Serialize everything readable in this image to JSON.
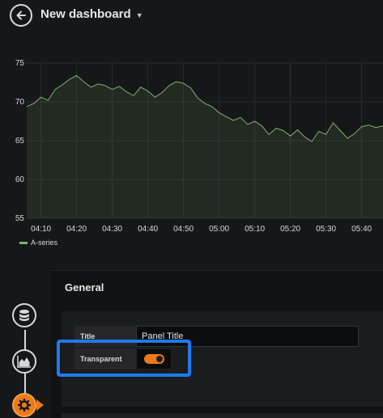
{
  "header": {
    "title": "New dashboard",
    "back_icon": "arrow-left-circle-icon",
    "caret_icon": "caret-down-icon"
  },
  "chart_data": {
    "type": "line",
    "title": "",
    "xlabel": "",
    "ylabel": "",
    "x_ticks": [
      "04:10",
      "04:20",
      "04:30",
      "04:40",
      "04:50",
      "05:00",
      "05:10",
      "05:20",
      "05:30",
      "05:40"
    ],
    "y_ticks": [
      "55",
      "60",
      "65",
      "70",
      "75"
    ],
    "ylim": [
      55,
      75
    ],
    "xlim": [
      "04:06",
      "05:46"
    ],
    "grid": true,
    "legend_position": "bottom-left",
    "series": [
      {
        "name": "A-series",
        "color": "#7eb26d",
        "x": [
          "04:06",
          "04:08",
          "04:10",
          "04:12",
          "04:14",
          "04:16",
          "04:18",
          "04:20",
          "04:22",
          "04:24",
          "04:26",
          "04:28",
          "04:30",
          "04:32",
          "04:34",
          "04:36",
          "04:38",
          "04:40",
          "04:42",
          "04:44",
          "04:46",
          "04:48",
          "04:50",
          "04:52",
          "04:54",
          "04:56",
          "04:58",
          "05:00",
          "05:02",
          "05:04",
          "05:06",
          "05:08",
          "05:10",
          "05:12",
          "05:14",
          "05:16",
          "05:18",
          "05:20",
          "05:22",
          "05:24",
          "05:26",
          "05:28",
          "05:30",
          "05:32",
          "05:34",
          "05:36",
          "05:38",
          "05:40",
          "05:42",
          "05:44",
          "05:46"
        ],
        "values": [
          69.4,
          69.8,
          70.6,
          70.2,
          71.6,
          72.2,
          72.9,
          73.4,
          72.6,
          71.9,
          72.3,
          72.1,
          71.6,
          72.0,
          71.3,
          70.8,
          71.9,
          71.4,
          70.6,
          71.2,
          72.1,
          72.6,
          72.4,
          71.8,
          70.5,
          69.8,
          69.4,
          68.6,
          68.1,
          67.6,
          68.0,
          67.1,
          67.5,
          66.9,
          65.8,
          66.6,
          66.3,
          65.6,
          66.4,
          65.5,
          64.9,
          66.2,
          65.8,
          67.3,
          66.3,
          65.3,
          65.9,
          66.8,
          67.0,
          66.7,
          66.9
        ]
      }
    ]
  },
  "legend": {
    "series_name": "A-series"
  },
  "panel": {
    "section_title": "General",
    "title_label": "Title",
    "title_value": "Panel Title",
    "transparent_label": "Transparent",
    "transparent_on": true
  },
  "sidebar": {
    "items": [
      {
        "icon": "database-icon",
        "active": false
      },
      {
        "icon": "area-chart-icon",
        "active": false
      },
      {
        "icon": "gear-icon",
        "active": true
      }
    ]
  },
  "colors": {
    "accent": "#eb7b18",
    "highlight": "#1e7bf0",
    "series": "#7eb26d"
  }
}
